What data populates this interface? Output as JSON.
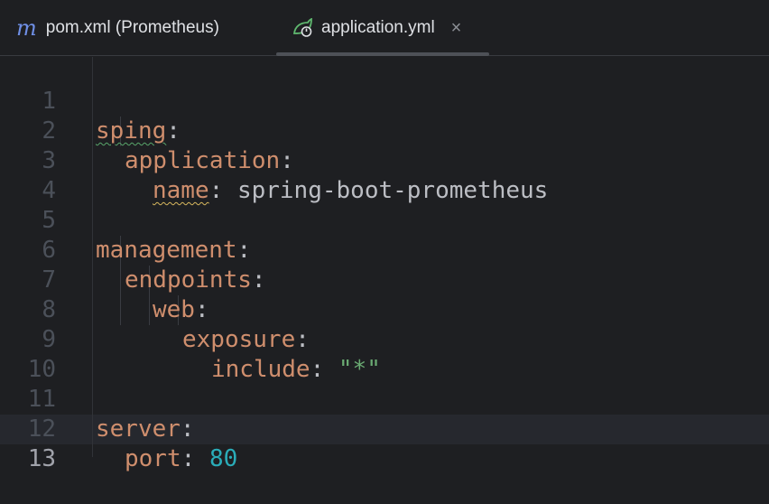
{
  "tabs": [
    {
      "label": "pom.xml (Prometheus)",
      "icon": "maven-icon",
      "icon_glyph": "m"
    },
    {
      "label": "application.yml",
      "icon": "spring-boot-icon",
      "close": "×"
    }
  ],
  "editor": {
    "current_line": "13",
    "lines": [
      {
        "n": "1",
        "key": "sping",
        "punct": ":"
      },
      {
        "n": "2",
        "key": "application",
        "punct": ":"
      },
      {
        "n": "3",
        "key": "name",
        "punct": ": ",
        "value": "spring-boot-prometheus"
      },
      {
        "n": "4"
      },
      {
        "n": "5",
        "key": "management",
        "punct": ":"
      },
      {
        "n": "6",
        "key": "endpoints",
        "punct": ":"
      },
      {
        "n": "7",
        "key": "web",
        "punct": ":"
      },
      {
        "n": "8",
        "key": "exposure",
        "punct": ":"
      },
      {
        "n": "9",
        "key": "include",
        "punct": ": ",
        "value": "\"*\""
      },
      {
        "n": "10"
      },
      {
        "n": "11",
        "key": "server",
        "punct": ":"
      },
      {
        "n": "12",
        "key": "port",
        "punct": ": ",
        "value": "80"
      },
      {
        "n": "13"
      }
    ]
  },
  "colors": {
    "key": "#cf8e6d",
    "string": "#6aab73",
    "number": "#2aacb8",
    "text": "#bcbec4",
    "background": "#1e1f22"
  }
}
